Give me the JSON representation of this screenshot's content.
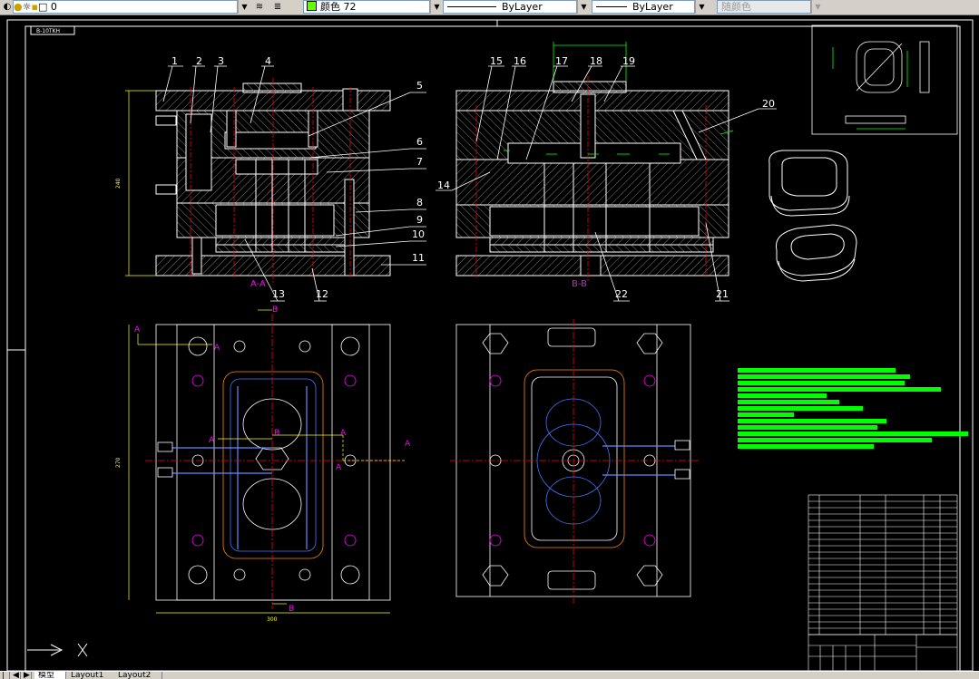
{
  "toolbar": {
    "layer_name": "0",
    "color_label": "颜色 72",
    "color_hex": "#66ff00",
    "linetype_label": "ByLayer",
    "lineweight_label": "ByLayer",
    "plotstyle_label": "随颜色"
  },
  "drawing": {
    "title_tag": "B-10TKH",
    "balloons": [
      "1",
      "2",
      "3",
      "4",
      "5",
      "6",
      "7",
      "8",
      "9",
      "10",
      "11",
      "12",
      "13",
      "14",
      "15",
      "16",
      "17",
      "18",
      "19",
      "20",
      "21",
      "22"
    ],
    "section_aa": "A-A",
    "section_bb": "B-B",
    "cut_a": "A",
    "cut_b": "B",
    "dim_height_left": "240",
    "dim_height_plan": "270",
    "dim_width_plan": "300"
  },
  "tabs": [
    "模型",
    "Layout1",
    "Layout2"
  ],
  "colors": {
    "canvas": "#000000",
    "line": "#ffffff",
    "hatch": "#8a8a8a",
    "centerline": "#ff0000",
    "dimension": "#ffff00",
    "section_label": "#ff00ff",
    "notes": "#00ff00",
    "water_line": "#6688ff",
    "cavity": "#4477ff"
  }
}
